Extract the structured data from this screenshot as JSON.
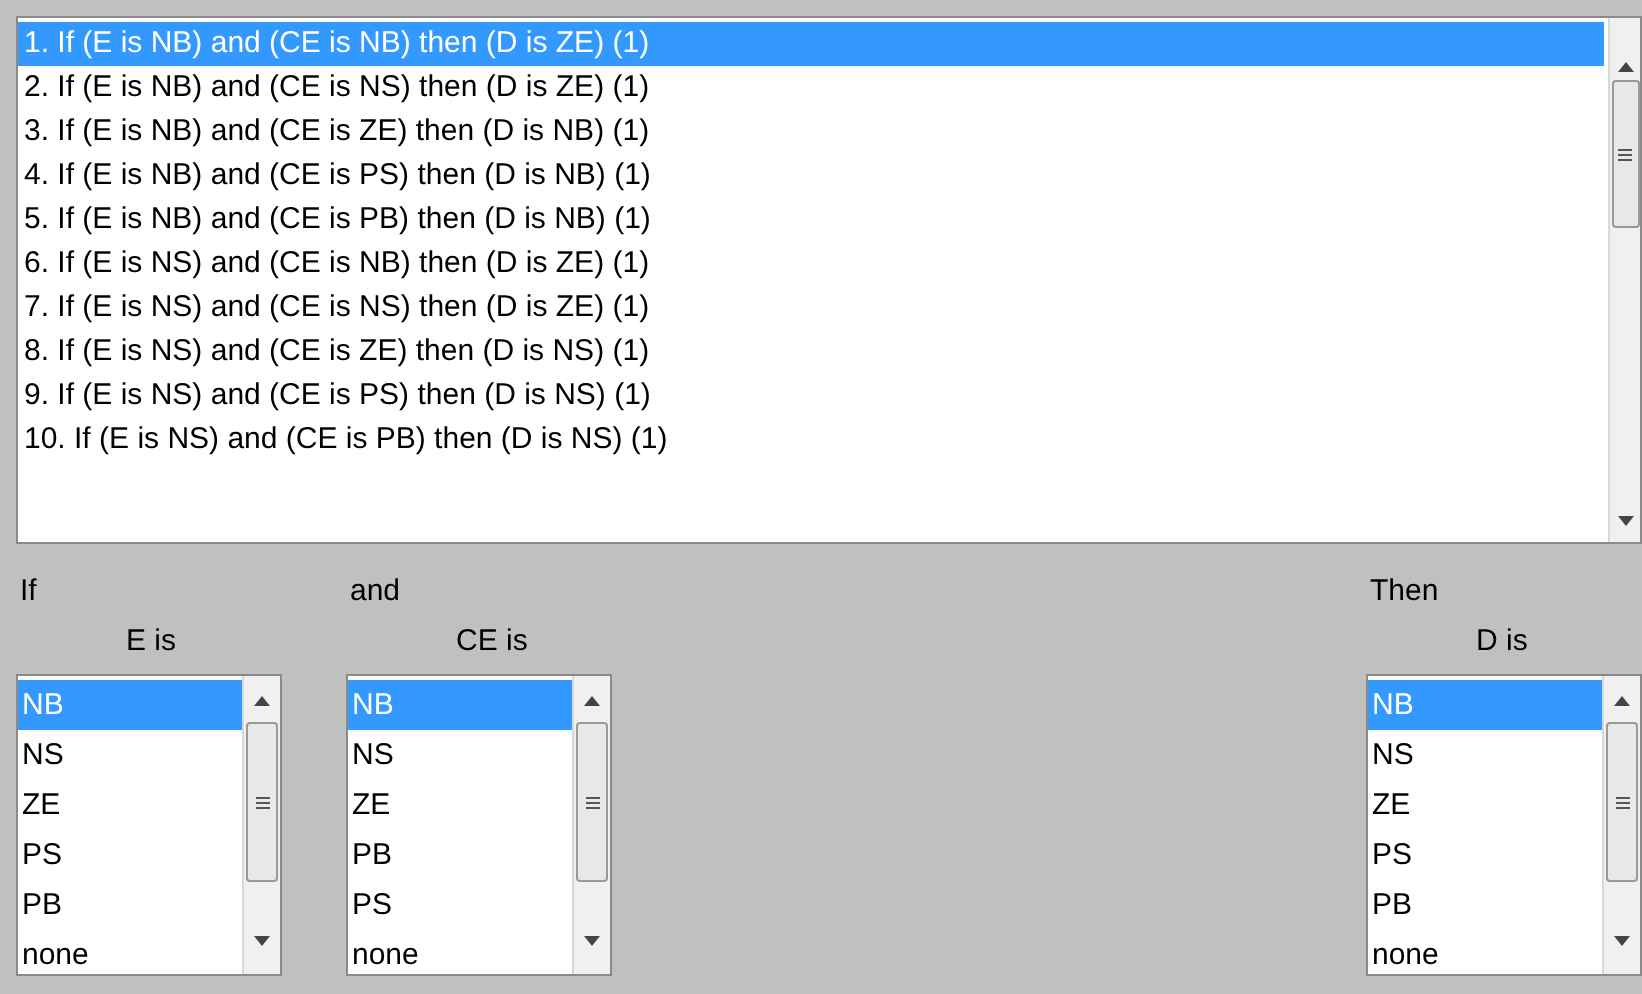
{
  "rules": [
    {
      "text": "1. If (E is NB) and (CE is NB) then (D is ZE) (1)",
      "selected": true
    },
    {
      "text": "2. If (E is NB) and (CE is NS) then (D is ZE) (1)",
      "selected": false
    },
    {
      "text": "3. If (E is NB) and (CE is ZE) then (D is NB) (1)",
      "selected": false
    },
    {
      "text": "4. If (E is NB) and (CE is PS) then (D is NB) (1)",
      "selected": false
    },
    {
      "text": "5. If (E is NB) and (CE is PB) then (D is NB) (1)",
      "selected": false
    },
    {
      "text": "6. If (E is NS) and (CE is NB) then (D is ZE) (1)",
      "selected": false
    },
    {
      "text": "7. If (E is NS) and (CE is NS) then (D is ZE) (1)",
      "selected": false
    },
    {
      "text": "8. If (E is NS) and (CE is ZE) then (D is NS) (1)",
      "selected": false
    },
    {
      "text": "9. If (E is NS) and (CE is PS) then (D is NS) (1)",
      "selected": false
    },
    {
      "text": "10. If (E is NS) and (CE is PB) then (D is NS) (1)",
      "selected": false
    }
  ],
  "columns": [
    {
      "kind": "input",
      "connective": "If",
      "variable": "E is",
      "items": [
        {
          "label": "NB",
          "selected": true
        },
        {
          "label": "NS",
          "selected": false
        },
        {
          "label": "ZE",
          "selected": false
        },
        {
          "label": "PS",
          "selected": false
        },
        {
          "label": "PB",
          "selected": false
        },
        {
          "label": "none",
          "selected": false
        }
      ]
    },
    {
      "kind": "input",
      "connective": "and",
      "variable": "CE is",
      "items": [
        {
          "label": "NB",
          "selected": true
        },
        {
          "label": "NS",
          "selected": false
        },
        {
          "label": "ZE",
          "selected": false
        },
        {
          "label": "PB",
          "selected": false
        },
        {
          "label": "PS",
          "selected": false
        },
        {
          "label": "none",
          "selected": false
        }
      ]
    },
    {
      "kind": "output",
      "connective": "Then",
      "variable": "D is",
      "items": [
        {
          "label": "NB",
          "selected": true
        },
        {
          "label": "NS",
          "selected": false
        },
        {
          "label": "ZE",
          "selected": false
        },
        {
          "label": "PS",
          "selected": false
        },
        {
          "label": "PB",
          "selected": false
        },
        {
          "label": "none",
          "selected": false
        }
      ]
    }
  ]
}
